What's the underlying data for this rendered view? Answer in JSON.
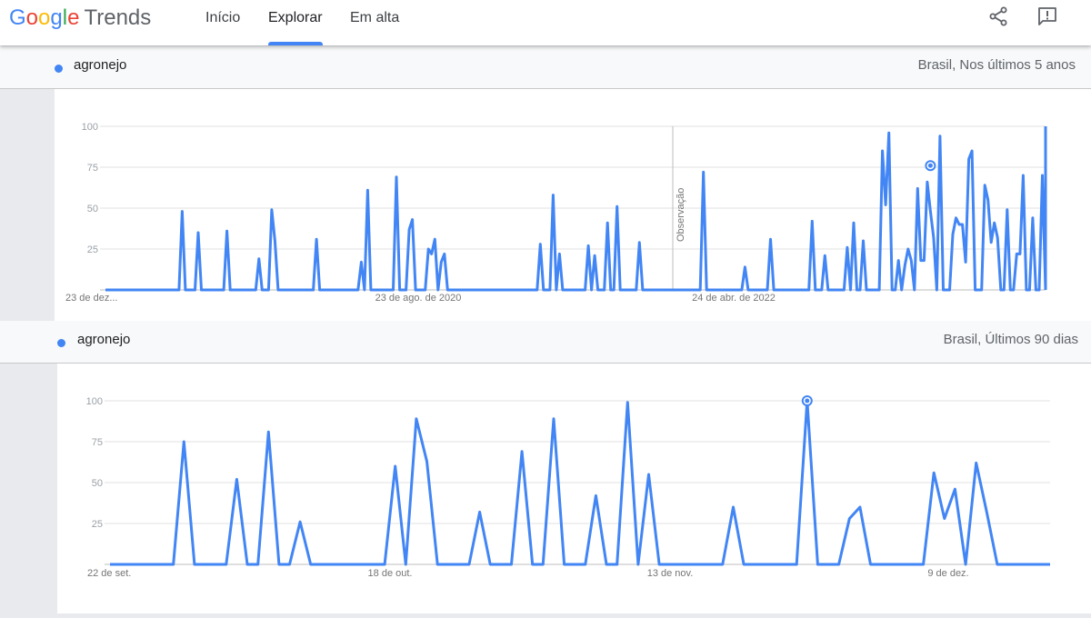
{
  "header": {
    "logo_word": "Google",
    "logo_product": "Trends",
    "nav": [
      {
        "label": "Início",
        "active": false
      },
      {
        "label": "Explorar",
        "active": true
      },
      {
        "label": "Em alta",
        "active": false
      }
    ],
    "share_icon": "share-icon",
    "feedback_icon": "feedback-icon"
  },
  "colors": {
    "series": "#4285f4",
    "accent": "#4285f4"
  },
  "panel1": {
    "term": "agronejo",
    "range": "Brasil, Nos últimos 5 anos"
  },
  "panel2": {
    "term": "agronejo",
    "range": "Brasil, Últimos 90 dias"
  },
  "chart_data": [
    {
      "type": "line",
      "series": [
        {
          "name": "agronejo",
          "values": [
            0,
            0,
            0,
            0,
            0,
            0,
            0,
            0,
            0,
            0,
            0,
            0,
            0,
            0,
            0,
            0,
            0,
            0,
            0,
            0,
            0,
            0,
            0,
            0,
            48,
            0,
            0,
            0,
            0,
            35,
            0,
            0,
            0,
            0,
            0,
            0,
            0,
            0,
            36,
            0,
            0,
            0,
            0,
            0,
            0,
            0,
            0,
            0,
            19,
            0,
            0,
            0,
            49,
            30,
            0,
            0,
            0,
            0,
            0,
            0,
            0,
            0,
            0,
            0,
            0,
            0,
            31,
            0,
            0,
            0,
            0,
            0,
            0,
            0,
            0,
            0,
            0,
            0,
            0,
            0,
            17,
            0,
            61,
            0,
            0,
            0,
            0,
            0,
            0,
            0,
            0,
            69,
            0,
            0,
            0,
            37,
            43,
            0,
            0,
            0,
            0,
            25,
            22,
            31,
            0,
            17,
            22,
            0,
            0,
            0,
            0,
            0,
            0,
            0,
            0,
            0,
            0,
            0,
            0,
            0,
            0,
            0,
            0,
            0,
            0,
            0,
            0,
            0,
            0,
            0,
            0,
            0,
            0,
            0,
            0,
            0,
            28,
            0,
            0,
            0,
            58,
            0,
            22,
            0,
            0,
            0,
            0,
            0,
            0,
            0,
            0,
            27,
            0,
            21,
            0,
            0,
            0,
            41,
            0,
            0,
            51,
            0,
            0,
            0,
            0,
            0,
            0,
            29,
            0,
            0,
            0,
            0,
            0,
            0,
            0,
            0,
            0,
            0,
            0,
            0,
            0,
            0,
            0,
            0,
            0,
            0,
            0,
            72,
            0,
            0,
            0,
            0,
            0,
            0,
            0,
            0,
            0,
            0,
            0,
            0,
            14,
            0,
            0,
            0,
            0,
            0,
            0,
            0,
            31,
            0,
            0,
            0,
            0,
            0,
            0,
            0,
            0,
            0,
            0,
            0,
            0,
            42,
            0,
            0,
            0,
            21,
            0,
            0,
            0,
            0,
            0,
            0,
            26,
            0,
            41,
            0,
            0,
            30,
            0,
            0,
            0,
            0,
            0,
            85,
            52,
            96,
            0,
            0,
            18,
            0,
            15,
            25,
            18,
            0,
            62,
            18,
            18,
            66,
            48,
            32,
            0,
            94,
            0,
            0,
            0,
            34,
            44,
            40,
            40,
            17,
            80,
            85,
            0,
            0,
            0,
            64,
            55,
            29,
            41,
            32,
            0,
            0,
            49,
            0,
            0,
            22,
            22,
            70,
            0,
            0,
            44,
            0,
            0,
            70,
            0
          ]
        }
      ],
      "x_ticks": [
        "23 de dez...",
        "23 de ago. de 2020",
        "24 de abr. de 2022"
      ],
      "y_ticks": [
        100,
        75,
        50,
        25
      ],
      "ylim": [
        0,
        100
      ],
      "annotation": "Observação",
      "partial_final_value": 100,
      "highlighted_value": 76
    },
    {
      "type": "line",
      "series": [
        {
          "name": "agronejo",
          "values": [
            0,
            0,
            0,
            0,
            0,
            0,
            0,
            75,
            0,
            0,
            0,
            0,
            52,
            0,
            0,
            81,
            0,
            0,
            26,
            0,
            0,
            0,
            0,
            0,
            0,
            0,
            0,
            60,
            0,
            89,
            63,
            0,
            0,
            0,
            0,
            32,
            0,
            0,
            0,
            69,
            0,
            0,
            89,
            0,
            0,
            0,
            42,
            0,
            0,
            99,
            0,
            55,
            0,
            0,
            0,
            0,
            0,
            0,
            0,
            35,
            0,
            0,
            0,
            0,
            0,
            0,
            100,
            0,
            0,
            0,
            28,
            35,
            0,
            0,
            0,
            0,
            0,
            0,
            56,
            28,
            46,
            0,
            62,
            32,
            0,
            0,
            0,
            0,
            0,
            0
          ]
        }
      ],
      "x_ticks": [
        "22 de set.",
        "18 de out.",
        "13 de nov.",
        "9 de dez."
      ],
      "y_ticks": [
        100,
        75,
        50,
        25
      ],
      "ylim": [
        0,
        100
      ],
      "highlighted_value": 100
    }
  ]
}
